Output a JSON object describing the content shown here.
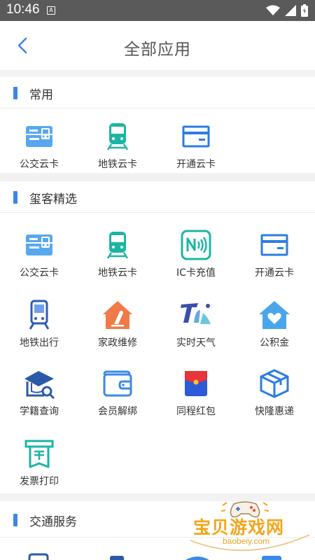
{
  "status_bar": {
    "time": "10:46",
    "notification_icon": "A"
  },
  "header": {
    "title": "全部应用",
    "back_icon": "chevron-left-icon"
  },
  "sections": [
    {
      "title": "常用",
      "apps": [
        {
          "label": "公交云卡",
          "icon": "bus-card-icon"
        },
        {
          "label": "地铁云卡",
          "icon": "metro-card-icon"
        },
        {
          "label": "开通云卡",
          "icon": "open-card-icon"
        }
      ]
    },
    {
      "title": "玺客精选",
      "apps": [
        {
          "label": "公交云卡",
          "icon": "bus-card-icon"
        },
        {
          "label": "地铁云卡",
          "icon": "metro-card-icon"
        },
        {
          "label": "IC卡充值",
          "icon": "nfc-recharge-icon"
        },
        {
          "label": "开通云卡",
          "icon": "open-card-icon"
        },
        {
          "label": "地铁出行",
          "icon": "metro-travel-icon"
        },
        {
          "label": "家政维修",
          "icon": "house-repair-icon"
        },
        {
          "label": "实时天气",
          "icon": "weather-icon"
        },
        {
          "label": "公积金",
          "icon": "housing-fund-icon"
        },
        {
          "label": "学籍查询",
          "icon": "student-search-icon"
        },
        {
          "label": "会员解绑",
          "icon": "wallet-icon"
        },
        {
          "label": "同程红包",
          "icon": "red-packet-icon"
        },
        {
          "label": "快隆惠递",
          "icon": "parcel-icon"
        },
        {
          "label": "发票打印",
          "icon": "invoice-print-icon"
        }
      ]
    },
    {
      "title": "交通服务",
      "apps": []
    }
  ],
  "watermark": {
    "text": "宝贝游戏网",
    "url": "baobeiy.com"
  },
  "colors": {
    "accent": "#3c86e8",
    "teal": "#1bb5a4",
    "orange": "#f07a48",
    "status_bar": "#5a5a5a"
  }
}
